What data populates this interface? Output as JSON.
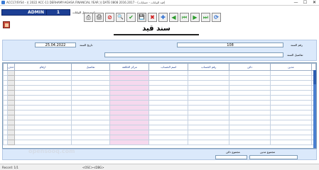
{
  "window": {
    "title": "ACC17/SYS4 - (( 2022 ACC-11 DERHAMY-AGHSA FINANCIAL YEAR )) DATE 0808 2016.2017 - (قيد البيانات - حسابات)",
    "controls": [
      "—",
      "☐",
      "✕"
    ]
  },
  "user": {
    "name": "ADMIN",
    "id": "1",
    "label": "اسم مدخل البيانات"
  },
  "toolbar": {
    "buttons": [
      "⎙",
      "🖨",
      "⊘",
      "🔍",
      "✔",
      "💾",
      "✖",
      "✚",
      "◀",
      "⏮",
      "▶",
      "⏭",
      "⟳"
    ]
  },
  "document": {
    "title": "سند قيد"
  },
  "header": {
    "doc_number_label": "رقم السند",
    "doc_number": "108",
    "date_label": "تاريخ السند",
    "date": "25.04.2022",
    "details_label": "تفاصيل السند",
    "details": ""
  },
  "grid": {
    "columns": [
      "مدين",
      "دائن",
      "رقم الحساب",
      "اسم الحساب",
      "مركز التكلفة",
      "تفاصيل",
      "ارقام",
      "حذف"
    ]
  },
  "totals": {
    "debit_label": "مجموع مدين",
    "credit_label": "مجموع دائن",
    "watermark": "opensooq.com"
  },
  "status": {
    "record": "Record: 1/1",
    "extra": "<OSC><DBG>"
  }
}
